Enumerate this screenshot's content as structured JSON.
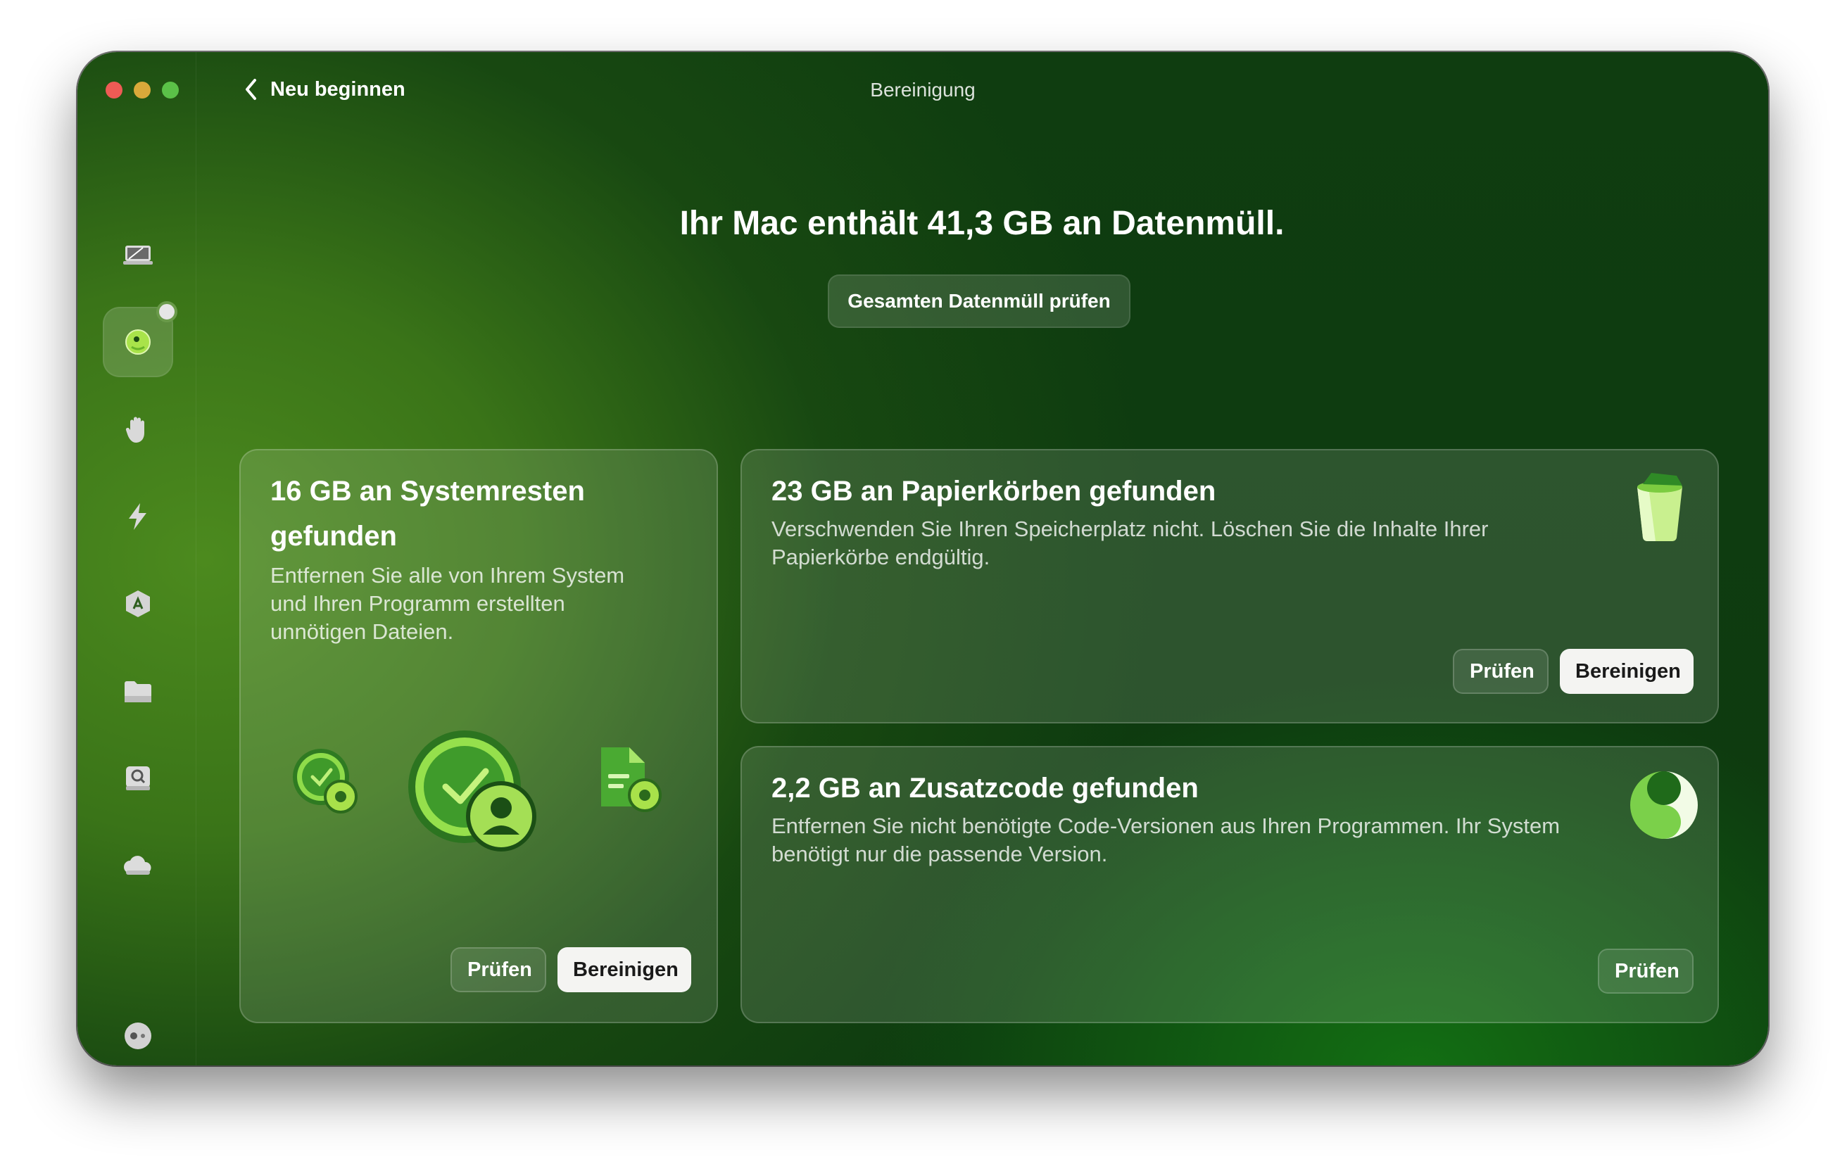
{
  "window": {
    "title": "Bereinigung"
  },
  "nav": {
    "back_label": "Neu beginnen"
  },
  "main": {
    "headline": "Ihr Mac enthält 41,3 GB an Datenmüll.",
    "review_all_label": "Gesamten Datenmüll prüfen"
  },
  "cards": {
    "system": {
      "title_line1": "16 GB an Systemresten",
      "title_line2": "gefunden",
      "desc_line1": "Entfernen Sie alle von Ihrem System",
      "desc_line2": "und Ihren Programm erstellten",
      "desc_line3": "unnötigen Dateien.",
      "review_label": "Prüfen",
      "clean_label": "Bereinigen"
    },
    "trash": {
      "title": "23 GB an Papierkörben gefunden",
      "desc_line1": "Verschwenden Sie Ihren Speicherplatz nicht. Löschen Sie die Inhalte Ihrer",
      "desc_line2": "Papierkörbe endgültig.",
      "review_label": "Prüfen",
      "clean_label": "Bereinigen"
    },
    "universal": {
      "title": "2,2 GB an Zusatzcode gefunden",
      "desc_line1": "Entfernen Sie nicht benötigte Code-Versionen aus Ihren Programmen. Ihr System",
      "desc_line2": "benötigt nur die passende Version.",
      "review_label": "Prüfen"
    }
  },
  "sidebar": {
    "items": [
      {
        "icon": "smart-care-icon"
      },
      {
        "icon": "cleanup-icon",
        "active": true
      },
      {
        "icon": "protection-icon"
      },
      {
        "icon": "performance-icon"
      },
      {
        "icon": "applications-icon"
      },
      {
        "icon": "my-clutter-icon"
      },
      {
        "icon": "space-lens-icon"
      },
      {
        "icon": "cloud-icon"
      },
      {
        "icon": "assistant-icon"
      }
    ]
  },
  "colors": {
    "accent_green": "#5bc148",
    "close": "#ee5b55",
    "minimize": "#d9a93a",
    "zoom": "#5bc148"
  }
}
